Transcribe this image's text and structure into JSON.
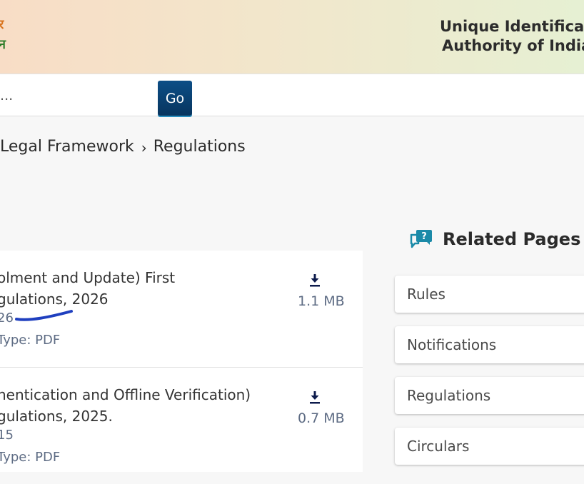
{
  "header": {
    "hindi_line1": "र",
    "hindi_line2": "न",
    "org_line1": "Unique Identificati",
    "org_line2": "Authority of India"
  },
  "search": {
    "placeholder": "h...",
    "go_label": "Go"
  },
  "breadcrumb": {
    "items": [
      "Legal Framework",
      "Regulations"
    ],
    "separator": "›"
  },
  "documents": [
    {
      "title_line1": "olment and Update) First",
      "title_line2": "gulations, 2026",
      "date": "26",
      "type": "Type: PDF",
      "size": "1.1 MB",
      "icon": "download-icon"
    },
    {
      "title_line1": "nentication and Offline Verification)",
      "title_line2": "gulations, 2025.",
      "date": "15",
      "type": "Type: PDF",
      "size": "0.7 MB",
      "icon": "download-icon"
    }
  ],
  "related": {
    "title": "Related Pages",
    "icon": "question-chat-icon",
    "items": [
      "Rules",
      "Notifications",
      "Regulations",
      "Circulars"
    ]
  },
  "colors": {
    "go_button": "#0c4e86",
    "accent_teal": "#1b8aa8",
    "underline_annotation": "#1f3fbf"
  }
}
